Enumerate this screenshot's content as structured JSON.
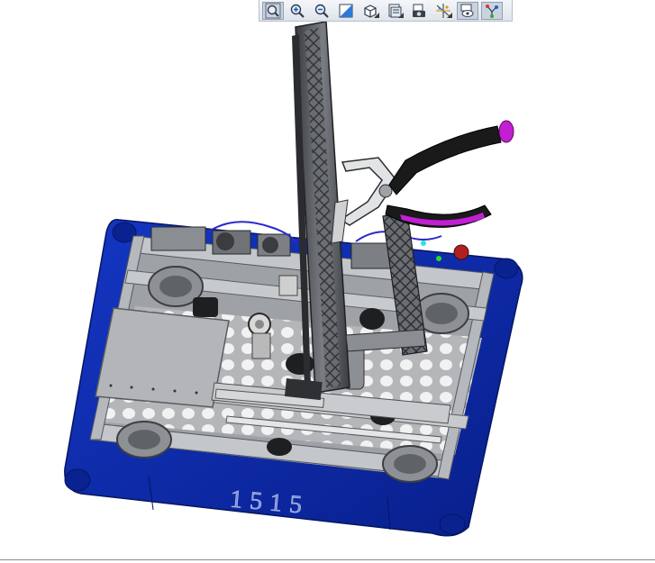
{
  "toolbar": {
    "buttons": [
      {
        "id": "refit",
        "icon": "refit-magnifier-icon",
        "active": true
      },
      {
        "id": "zoom_in",
        "icon": "zoom-in-icon",
        "active": false
      },
      {
        "id": "zoom_out",
        "icon": "zoom-out-icon",
        "active": false
      },
      {
        "id": "repaint",
        "icon": "repaint-icon",
        "active": false
      },
      {
        "id": "display_style",
        "icon": "display-style-cube-icon",
        "active": false,
        "has_dropdown": true
      },
      {
        "id": "saved_views",
        "icon": "saved-orientations-icon",
        "active": false,
        "has_dropdown": true
      },
      {
        "id": "view_manager",
        "icon": "view-manager-camera-icon",
        "active": false
      },
      {
        "id": "datum_display",
        "icon": "datum-display-filters-icon",
        "active": false,
        "has_dropdown": true
      },
      {
        "id": "annotation_display",
        "icon": "annotation-display-icon",
        "active": true
      },
      {
        "id": "spin_center",
        "icon": "spin-center-icon",
        "active": true
      }
    ]
  },
  "model": {
    "name": "robot-assembly",
    "bumper_label": "1515",
    "colors": {
      "bumper": "#0c28a8",
      "bumper_dark": "#071a78",
      "frame": "#a9adb2",
      "frame_dark": "#6d7176",
      "lift": "#4a4c50",
      "grip": "#1a1a1a",
      "grip_accent": "#c21fd2",
      "wiring": "#2a2ac8"
    }
  }
}
